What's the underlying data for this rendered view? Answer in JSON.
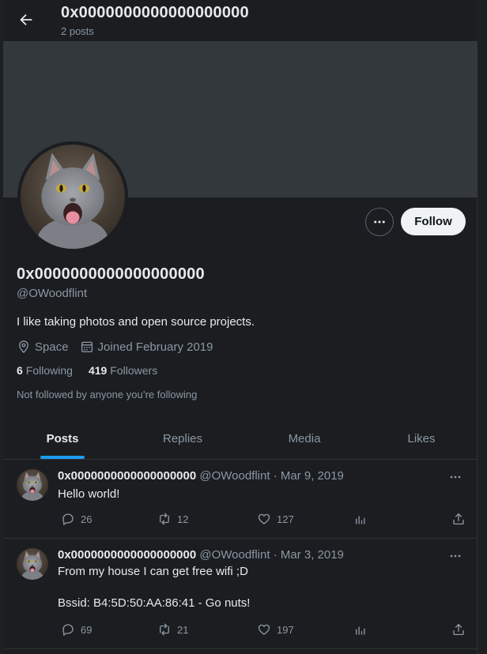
{
  "header": {
    "title": "0x0000000000000000000",
    "posts_count": "2 posts"
  },
  "profile": {
    "name": "0x0000000000000000000",
    "handle": "@OWoodflint",
    "bio": "I like taking photos and open source projects.",
    "location": "Space",
    "joined": "Joined February 2019",
    "following_count": "6",
    "following_label": "Following",
    "followers_count": "419",
    "followers_label": "Followers",
    "not_followed": "Not followed by anyone you’re following",
    "follow_label": "Follow"
  },
  "tabs": [
    {
      "label": "Posts",
      "active": true
    },
    {
      "label": "Replies",
      "active": false
    },
    {
      "label": "Media",
      "active": false
    },
    {
      "label": "Likes",
      "active": false
    }
  ],
  "posts": [
    {
      "name": "0x0000000000000000000",
      "meta": " @OWoodflint · Mar 9, 2019",
      "text_lines": [
        "Hello world!"
      ],
      "replies": "26",
      "reposts": "12",
      "likes": "127"
    },
    {
      "name": "0x0000000000000000000",
      "meta": " @OWoodflint · Mar 3, 2019",
      "text_lines": [
        "From my house I can get free wifi ;D",
        "",
        "Bssid: B4:5D:50:AA:86:41 - Go nuts!"
      ],
      "replies": "69",
      "reposts": "21",
      "likes": "197"
    }
  ],
  "icons": {
    "back": "arrow-left-icon",
    "location": "location-pin-icon",
    "calendar": "calendar-icon",
    "more": "more-dots-icon",
    "reply": "reply-bubble-icon",
    "repost": "repost-icon",
    "like": "heart-icon",
    "views": "analytics-icon",
    "share": "share-icon"
  },
  "colors": {
    "accent": "#1d9bf0",
    "background": "#1b1d20",
    "banner": "#33383c",
    "muted_text": "#8b98a5"
  }
}
